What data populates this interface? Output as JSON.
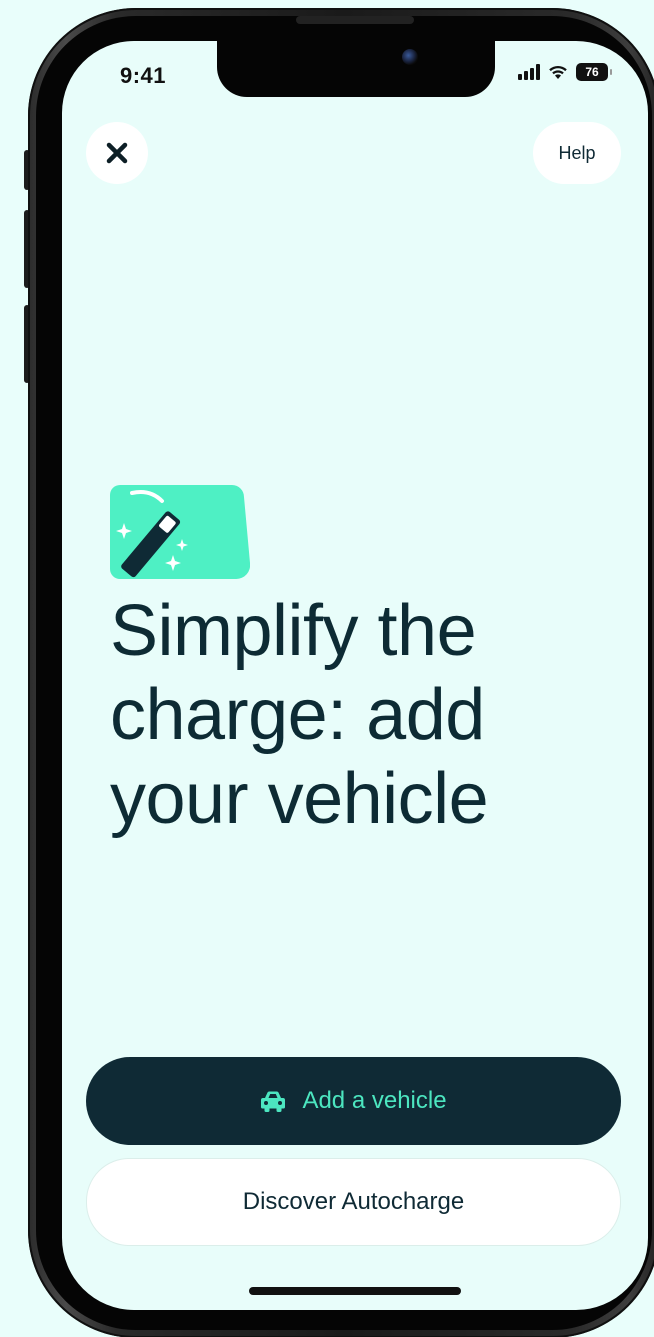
{
  "status_bar": {
    "time": "9:41",
    "battery_level": "76",
    "icons": [
      "signal-icon",
      "wifi-icon",
      "battery-icon"
    ]
  },
  "header": {
    "close_icon": "close-icon",
    "help_label": "Help"
  },
  "hero": {
    "icon": "magic-wand-icon",
    "headline": "Simplify the charge: add your vehicle"
  },
  "actions": {
    "primary_label": "Add a vehicle",
    "primary_icon": "car-icon",
    "secondary_label": "Discover Autocharge"
  },
  "colors": {
    "background": "#e8fdfa",
    "primary_button": "#0f2a35",
    "accent": "#4ce6c0",
    "text": "#0d2b34"
  }
}
